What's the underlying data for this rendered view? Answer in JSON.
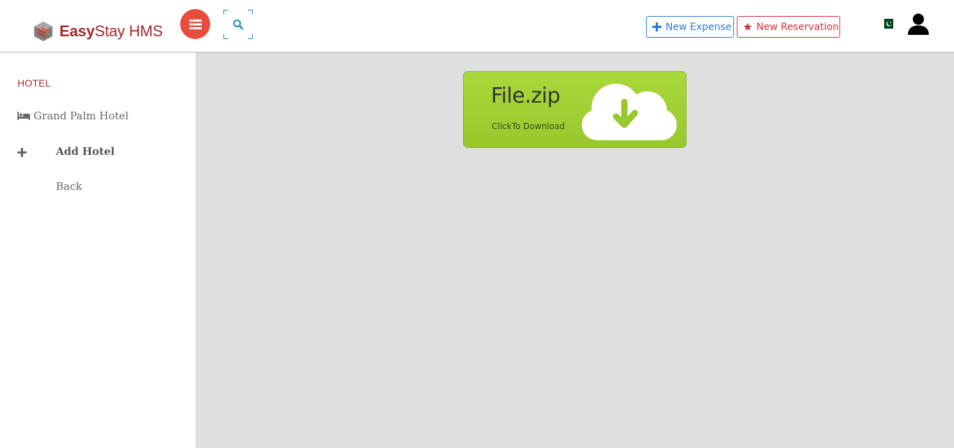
{
  "brand": {
    "name_bold": "Easy",
    "name_rest": "Stay HMS"
  },
  "header": {
    "new_expense_label": "New Expense",
    "new_reservation_label": "New Reservation"
  },
  "sidebar": {
    "heading": "HOTEL",
    "items": [
      {
        "label": "Grand Palm Hotel",
        "icon": "bed-icon"
      },
      {
        "label": "Add Hotel",
        "icon": "plus-icon"
      },
      {
        "label": "Back"
      }
    ]
  },
  "download": {
    "filename": "File.zip",
    "subtitle": "ClickTo Download",
    "icon": "cloud-download-icon"
  },
  "colors": {
    "brand": "#a3282f",
    "menu_toggle": "#e84c3d",
    "expense": "#2a7bd6",
    "reservation": "#d3303f",
    "download_green": "#a9d83b",
    "content_bg": "#dfdfdf"
  }
}
